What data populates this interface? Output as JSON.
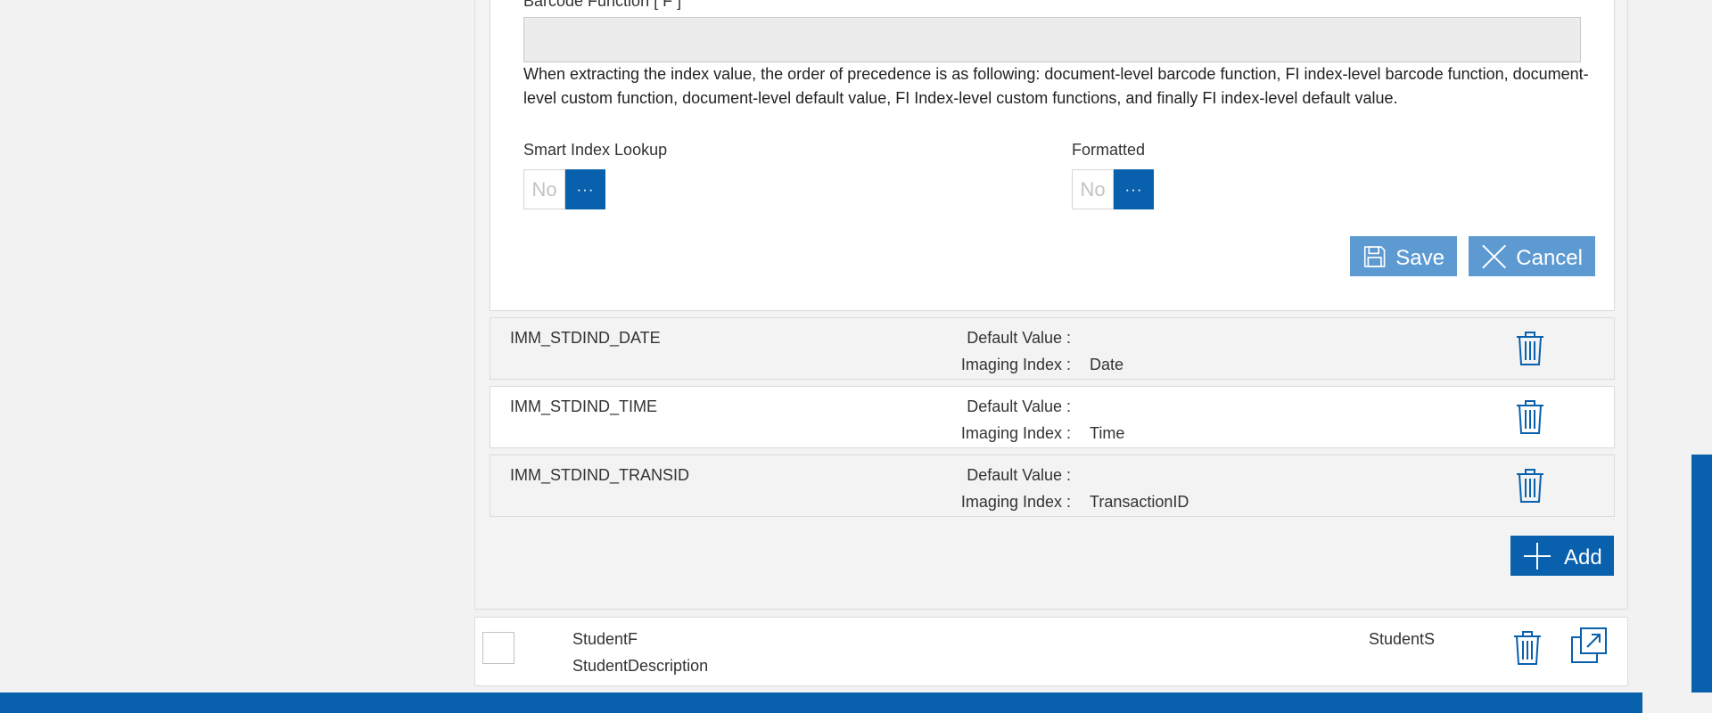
{
  "form": {
    "barcode_label": "Barcode Function [ F ]",
    "barcode_value": "",
    "precedence_note": "When extracting the index value, the order of precedence is as following: document-level barcode function, FI index-level barcode function, document-level custom function, document-level default value, FI Index-level custom functions, and finally FI index-level default value.",
    "smart_index_label": "Smart Index Lookup",
    "smart_index_value": "No",
    "formatted_label": "Formatted",
    "formatted_value": "No",
    "toggle_knob": "···",
    "save_label": "Save",
    "cancel_label": "Cancel"
  },
  "index_rows": [
    {
      "name": "IMM_STDIND_DATE",
      "default_key": "Default Value :",
      "default_value": "",
      "imaging_key": "Imaging Index :",
      "imaging_value": "Date"
    },
    {
      "name": "IMM_STDIND_TIME",
      "default_key": "Default Value :",
      "default_value": "",
      "imaging_key": "Imaging Index :",
      "imaging_value": "Time"
    },
    {
      "name": "IMM_STDIND_TRANSID",
      "default_key": "Default Value :",
      "default_value": "",
      "imaging_key": "Imaging Index :",
      "imaging_value": "TransactionID"
    }
  ],
  "add_label": "Add",
  "student": {
    "field_name": "StudentF",
    "description": "StudentDescription",
    "short_name": "StudentS"
  },
  "colors": {
    "brand_blue": "#0960ad",
    "button_light_blue": "#5e9ad2"
  },
  "icons": {
    "save": "save-icon",
    "cancel": "close-icon",
    "delete": "trash-icon",
    "add": "plus-icon",
    "open": "open-external-icon"
  }
}
